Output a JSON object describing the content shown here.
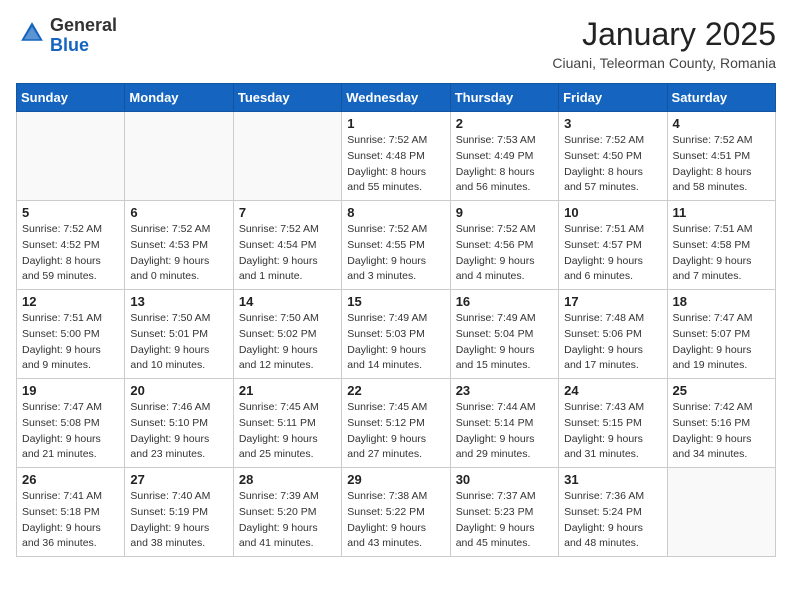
{
  "logo": {
    "general": "General",
    "blue": "Blue"
  },
  "title": "January 2025",
  "location": "Ciuani, Teleorman County, Romania",
  "weekdays": [
    "Sunday",
    "Monday",
    "Tuesday",
    "Wednesday",
    "Thursday",
    "Friday",
    "Saturday"
  ],
  "weeks": [
    [
      {
        "day": "",
        "info": ""
      },
      {
        "day": "",
        "info": ""
      },
      {
        "day": "",
        "info": ""
      },
      {
        "day": "1",
        "info": "Sunrise: 7:52 AM\nSunset: 4:48 PM\nDaylight: 8 hours\nand 55 minutes."
      },
      {
        "day": "2",
        "info": "Sunrise: 7:53 AM\nSunset: 4:49 PM\nDaylight: 8 hours\nand 56 minutes."
      },
      {
        "day": "3",
        "info": "Sunrise: 7:52 AM\nSunset: 4:50 PM\nDaylight: 8 hours\nand 57 minutes."
      },
      {
        "day": "4",
        "info": "Sunrise: 7:52 AM\nSunset: 4:51 PM\nDaylight: 8 hours\nand 58 minutes."
      }
    ],
    [
      {
        "day": "5",
        "info": "Sunrise: 7:52 AM\nSunset: 4:52 PM\nDaylight: 8 hours\nand 59 minutes."
      },
      {
        "day": "6",
        "info": "Sunrise: 7:52 AM\nSunset: 4:53 PM\nDaylight: 9 hours\nand 0 minutes."
      },
      {
        "day": "7",
        "info": "Sunrise: 7:52 AM\nSunset: 4:54 PM\nDaylight: 9 hours\nand 1 minute."
      },
      {
        "day": "8",
        "info": "Sunrise: 7:52 AM\nSunset: 4:55 PM\nDaylight: 9 hours\nand 3 minutes."
      },
      {
        "day": "9",
        "info": "Sunrise: 7:52 AM\nSunset: 4:56 PM\nDaylight: 9 hours\nand 4 minutes."
      },
      {
        "day": "10",
        "info": "Sunrise: 7:51 AM\nSunset: 4:57 PM\nDaylight: 9 hours\nand 6 minutes."
      },
      {
        "day": "11",
        "info": "Sunrise: 7:51 AM\nSunset: 4:58 PM\nDaylight: 9 hours\nand 7 minutes."
      }
    ],
    [
      {
        "day": "12",
        "info": "Sunrise: 7:51 AM\nSunset: 5:00 PM\nDaylight: 9 hours\nand 9 minutes."
      },
      {
        "day": "13",
        "info": "Sunrise: 7:50 AM\nSunset: 5:01 PM\nDaylight: 9 hours\nand 10 minutes."
      },
      {
        "day": "14",
        "info": "Sunrise: 7:50 AM\nSunset: 5:02 PM\nDaylight: 9 hours\nand 12 minutes."
      },
      {
        "day": "15",
        "info": "Sunrise: 7:49 AM\nSunset: 5:03 PM\nDaylight: 9 hours\nand 14 minutes."
      },
      {
        "day": "16",
        "info": "Sunrise: 7:49 AM\nSunset: 5:04 PM\nDaylight: 9 hours\nand 15 minutes."
      },
      {
        "day": "17",
        "info": "Sunrise: 7:48 AM\nSunset: 5:06 PM\nDaylight: 9 hours\nand 17 minutes."
      },
      {
        "day": "18",
        "info": "Sunrise: 7:47 AM\nSunset: 5:07 PM\nDaylight: 9 hours\nand 19 minutes."
      }
    ],
    [
      {
        "day": "19",
        "info": "Sunrise: 7:47 AM\nSunset: 5:08 PM\nDaylight: 9 hours\nand 21 minutes."
      },
      {
        "day": "20",
        "info": "Sunrise: 7:46 AM\nSunset: 5:10 PM\nDaylight: 9 hours\nand 23 minutes."
      },
      {
        "day": "21",
        "info": "Sunrise: 7:45 AM\nSunset: 5:11 PM\nDaylight: 9 hours\nand 25 minutes."
      },
      {
        "day": "22",
        "info": "Sunrise: 7:45 AM\nSunset: 5:12 PM\nDaylight: 9 hours\nand 27 minutes."
      },
      {
        "day": "23",
        "info": "Sunrise: 7:44 AM\nSunset: 5:14 PM\nDaylight: 9 hours\nand 29 minutes."
      },
      {
        "day": "24",
        "info": "Sunrise: 7:43 AM\nSunset: 5:15 PM\nDaylight: 9 hours\nand 31 minutes."
      },
      {
        "day": "25",
        "info": "Sunrise: 7:42 AM\nSunset: 5:16 PM\nDaylight: 9 hours\nand 34 minutes."
      }
    ],
    [
      {
        "day": "26",
        "info": "Sunrise: 7:41 AM\nSunset: 5:18 PM\nDaylight: 9 hours\nand 36 minutes."
      },
      {
        "day": "27",
        "info": "Sunrise: 7:40 AM\nSunset: 5:19 PM\nDaylight: 9 hours\nand 38 minutes."
      },
      {
        "day": "28",
        "info": "Sunrise: 7:39 AM\nSunset: 5:20 PM\nDaylight: 9 hours\nand 41 minutes."
      },
      {
        "day": "29",
        "info": "Sunrise: 7:38 AM\nSunset: 5:22 PM\nDaylight: 9 hours\nand 43 minutes."
      },
      {
        "day": "30",
        "info": "Sunrise: 7:37 AM\nSunset: 5:23 PM\nDaylight: 9 hours\nand 45 minutes."
      },
      {
        "day": "31",
        "info": "Sunrise: 7:36 AM\nSunset: 5:24 PM\nDaylight: 9 hours\nand 48 minutes."
      },
      {
        "day": "",
        "info": ""
      }
    ]
  ]
}
